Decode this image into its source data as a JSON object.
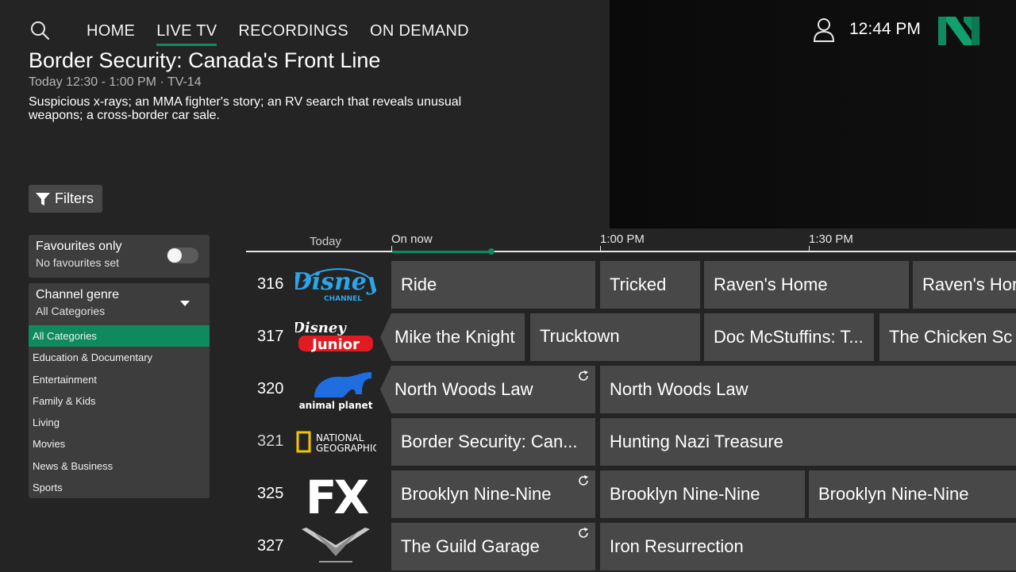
{
  "nav": {
    "items": [
      "HOME",
      "LIVE TV",
      "RECORDINGS",
      "ON DEMAND"
    ],
    "active_index": 1,
    "clock": "12:44 PM"
  },
  "program": {
    "title": "Border Security: Canada's Front Line",
    "meta": "Today 12:30 - 1:00 PM · TV-14",
    "description": "Suspicious x-rays; an MMA fighter's story; an RV search that reveals unusual weapons; a cross-border car sale."
  },
  "filters": {
    "button_label": "Filters",
    "favourites_title": "Favourites only",
    "favourites_sub": "No favourites set",
    "favourites_on": false,
    "genre_title": "Channel genre",
    "genre_value": "All Categories",
    "genre_options": [
      "All Categories",
      "Education & Documentary",
      "Entertainment",
      "Family & Kids",
      "Living",
      "Movies",
      "News & Business",
      "Sports"
    ],
    "genre_selected_index": 0
  },
  "timeline": {
    "today": "Today",
    "on_now": "On now",
    "t1": "1:00 PM",
    "t2": "1:30 PM"
  },
  "channels": [
    {
      "number": "316",
      "logo": "disney-channel-logo",
      "programs": [
        {
          "title": "Ride"
        },
        {
          "title": "Tricked"
        },
        {
          "title": "Raven's Home"
        },
        {
          "title": "Raven's Hor"
        }
      ]
    },
    {
      "number": "317",
      "logo": "disney-junior-logo",
      "programs": [
        {
          "title": "Mike the Knight"
        },
        {
          "title": "Trucktown"
        },
        {
          "title": "Doc McStuffins: T..."
        },
        {
          "title": "The Chicken Sc"
        }
      ]
    },
    {
      "number": "320",
      "logo": "animal-planet-logo",
      "logo_text": "animal planet",
      "programs": [
        {
          "title": "North Woods Law"
        },
        {
          "title": "North Woods Law"
        }
      ]
    },
    {
      "number": "321",
      "logo": "national-geographic-logo",
      "logo_text_1": "NATIONAL",
      "logo_text_2": "GEOGRAPHIC",
      "programs": [
        {
          "title": "Border Security: Can..."
        },
        {
          "title": "Hunting Nazi Treasure"
        }
      ]
    },
    {
      "number": "325",
      "logo": "fx-logo",
      "logo_text": "FX",
      "programs": [
        {
          "title": "Brooklyn Nine-Nine"
        },
        {
          "title": "Brooklyn Nine-Nine"
        },
        {
          "title": "Brooklyn Nine-Nine"
        }
      ]
    },
    {
      "number": "327",
      "logo": "discovery-velocity-logo",
      "programs": [
        {
          "title": "The Guild Garage"
        },
        {
          "title": "Iron Resurrection"
        }
      ]
    }
  ],
  "colors": {
    "accent": "#0f8a5f",
    "cell": "#484848",
    "background": "#242424"
  }
}
